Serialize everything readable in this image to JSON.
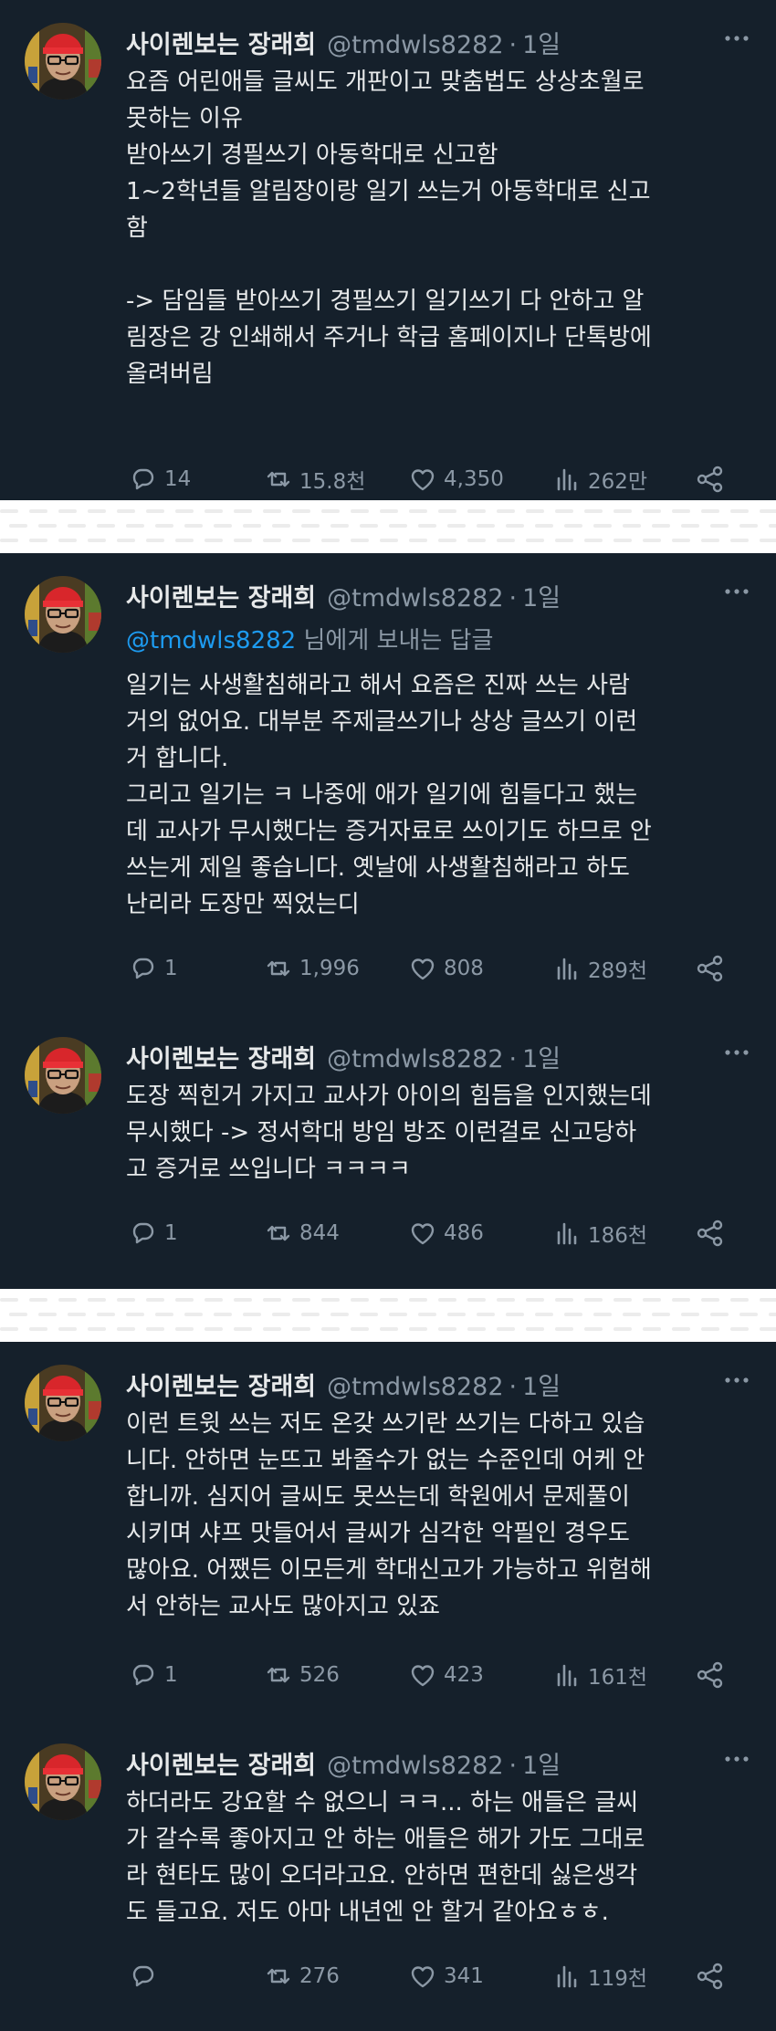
{
  "author": {
    "name": "사이렌보는 장래희",
    "handle": "@tmdwls8282",
    "time": "1일"
  },
  "reply_prefix": "님에게 보내는 답글",
  "reply_mention": "@tmdwls8282",
  "colors": {
    "background": "#15202b",
    "text": "#e7e9ea",
    "muted": "#8b98a5",
    "link": "#1d9bf0"
  },
  "tweets": [
    {
      "lines": [
        "요즘 어린애들 글씨도 개판이고 맞춤법도 상상초월로",
        "못하는 이유",
        "받아쓰기 경필쓰기 아동학대로 신고함",
        "1~2학년들 알림장이랑 일기 쓰는거 아동학대로 신고",
        "함",
        "",
        "-> 담임들 받아쓰기 경필쓰기 일기쓰기 다 안하고 알",
        "림장은 강 인쇄해서 주거나 학급 홈페이지나 단톡방에",
        "올려버림"
      ],
      "stats": {
        "replies": "14",
        "retweets": "15.8천",
        "likes": "4,350",
        "views": "262만"
      }
    },
    {
      "lines": [
        "일기는 사생활침해라고 해서 요즘은 진짜 쓰는 사람",
        "거의 없어요. 대부분 주제글쓰기나 상상 글쓰기 이런",
        "거 합니다.",
        "그리고 일기는 ㅋ 나중에 애가 일기에 힘들다고 했는",
        "데 교사가 무시했다는 증거자료로 쓰이기도 하므로 안",
        "쓰는게 제일 좋습니다. 옛날에 사생활침해라고 하도",
        "난리라 도장만 찍었는디"
      ],
      "stats": {
        "replies": "1",
        "retweets": "1,996",
        "likes": "808",
        "views": "289천"
      }
    },
    {
      "lines": [
        "도장 찍힌거 가지고 교사가 아이의 힘듬을 인지했는데",
        "무시했다 -> 정서학대 방임 방조 이런걸로 신고당하",
        "고 증거로 쓰입니다 ㅋㅋㅋㅋ"
      ],
      "stats": {
        "replies": "1",
        "retweets": "844",
        "likes": "486",
        "views": "186천"
      }
    },
    {
      "lines": [
        "이런 트윗 쓰는 저도 온갖 쓰기란 쓰기는 다하고 있습",
        "니다. 안하면 눈뜨고 봐줄수가 없는 수준인데 어케 안",
        "합니까. 심지어 글씨도 못쓰는데 학원에서 문제풀이",
        "시키며 샤프 맛들어서 글씨가 심각한 악필인 경우도",
        "많아요. 어쨌든 이모든게 학대신고가 가능하고 위험해",
        "서 안하는 교사도 많아지고 있죠"
      ],
      "stats": {
        "replies": "1",
        "retweets": "526",
        "likes": "423",
        "views": "161천"
      }
    },
    {
      "lines": [
        "하더라도 강요할 수 없으니 ㅋㅋ... 하는 애들은 글씨",
        "가 갈수록 좋아지고 안 하는 애들은 해가 가도 그대로",
        "라 현타도 많이 오더라고요. 안하면 편한데 싫은생각",
        "도 들고요. 저도 아마 내년엔 안 할거 같아요ㅎㅎ."
      ],
      "stats": {
        "replies": "",
        "retweets": "276",
        "likes": "341",
        "views": "119천"
      }
    }
  ]
}
